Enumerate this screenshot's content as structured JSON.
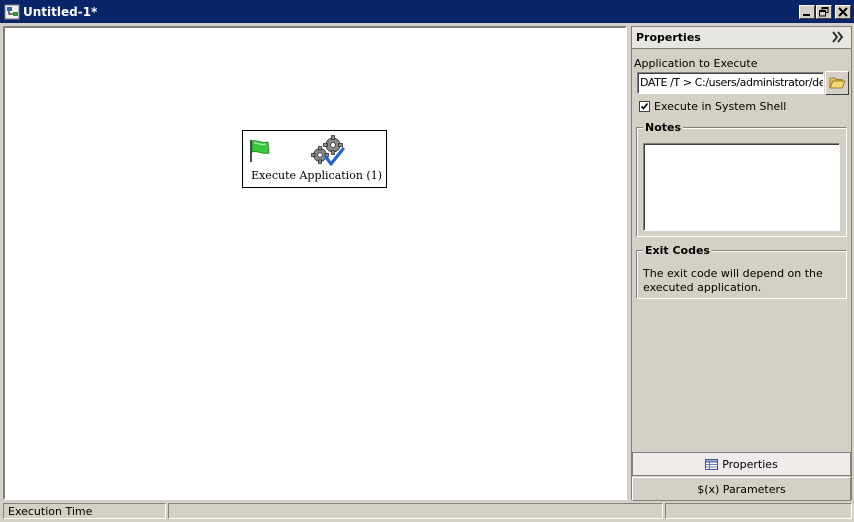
{
  "window": {
    "title": "Untitled-1*",
    "title_bar_color": "#0a246a"
  },
  "canvas": {
    "node": {
      "label": "Execute Application (1)",
      "icons": [
        "green-flag-icon",
        "gears-check-icon"
      ]
    }
  },
  "properties": {
    "header": "Properties",
    "app_label": "Application to Execute",
    "app_value": "DATE /T > C:/users/administrator/desktop",
    "execute_in_shell_label": "Execute in System Shell",
    "execute_in_shell_checked": true,
    "notes_label": "Notes",
    "notes_value": "",
    "exit_codes_label": "Exit Codes",
    "exit_codes_text": "The exit code will depend on the executed application.",
    "tab_properties": "Properties",
    "tab_parameters": "$(x) Parameters"
  },
  "statusbar": {
    "cell1": "Execution Time",
    "cell2": "",
    "cell3": ""
  }
}
